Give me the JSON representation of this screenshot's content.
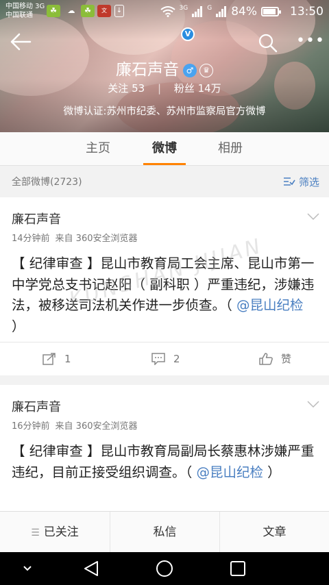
{
  "status_bar": {
    "carrier_1": "中国移动 3G",
    "carrier_2": "中国联通",
    "network_3g": "3G",
    "network_g": "G",
    "battery_percent": "84%",
    "time": "13:50"
  },
  "profile": {
    "name": "廉石声音",
    "following_label": "关注",
    "following_count": "53",
    "followers_label": "粉丝",
    "followers_count": "14万",
    "verification": "微博认证:苏州市纪委、苏州市监察局官方微博"
  },
  "tabs": [
    {
      "label": "主页",
      "active": false
    },
    {
      "label": "微博",
      "active": true
    },
    {
      "label": "相册",
      "active": false
    }
  ],
  "filter": {
    "count_label": "全部微博(2723)",
    "filter_label": "筛选"
  },
  "posts": [
    {
      "author": "廉石声音",
      "time": "14分钟前",
      "source": "来自 360安全浏览器",
      "text": "【 纪律审查 】昆山市教育局工会主席、昆山市第一中学党总支书记赵阳（ 副科职 ）严重违纪，涉嫌违法，被移送司法机关作进一步侦查。（ ",
      "mention": "@昆山纪检",
      "text_end": " ）",
      "repost_count": "1",
      "comment_count": "2",
      "like_label": "赞"
    },
    {
      "author": "廉石声音",
      "time": "16分钟前",
      "source": "来自 360安全浏览器",
      "text": "【 纪律审查 】昆山市教育局副局长蔡惠林涉嫌严重违纪，目前正接受组织调查。（ ",
      "mention": "@昆山纪检",
      "text_end": " ）"
    }
  ],
  "watermark": "KUNSHAN JIJIAN",
  "toolbar": {
    "followed_label": "已关注",
    "message_label": "私信",
    "article_label": "文章"
  },
  "colors": {
    "accent": "#ff8200",
    "link": "#4a7fc1"
  },
  "icons": [
    "back-arrow-icon",
    "search-icon",
    "more-icon",
    "verified-v-icon",
    "male-icon",
    "crown-icon",
    "filter-icon",
    "chevron-down-icon",
    "repost-icon",
    "comment-icon",
    "like-icon",
    "menu-lines-icon"
  ]
}
